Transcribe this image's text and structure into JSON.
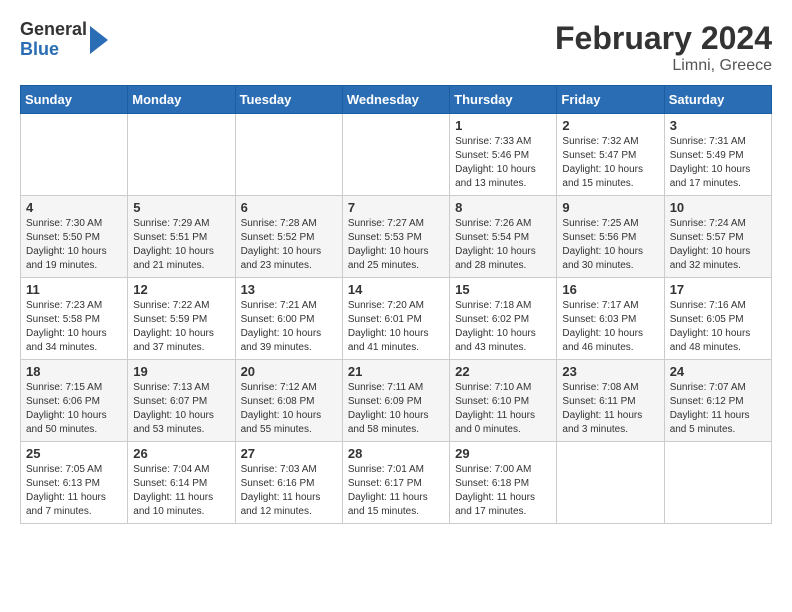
{
  "header": {
    "logo": {
      "general": "General",
      "blue": "Blue"
    },
    "title": "February 2024",
    "subtitle": "Limni, Greece"
  },
  "calendar": {
    "weekdays": [
      "Sunday",
      "Monday",
      "Tuesday",
      "Wednesday",
      "Thursday",
      "Friday",
      "Saturday"
    ],
    "weeks": [
      [
        {
          "day": "",
          "info": ""
        },
        {
          "day": "",
          "info": ""
        },
        {
          "day": "",
          "info": ""
        },
        {
          "day": "",
          "info": ""
        },
        {
          "day": "1",
          "info": "Sunrise: 7:33 AM\nSunset: 5:46 PM\nDaylight: 10 hours\nand 13 minutes."
        },
        {
          "day": "2",
          "info": "Sunrise: 7:32 AM\nSunset: 5:47 PM\nDaylight: 10 hours\nand 15 minutes."
        },
        {
          "day": "3",
          "info": "Sunrise: 7:31 AM\nSunset: 5:49 PM\nDaylight: 10 hours\nand 17 minutes."
        }
      ],
      [
        {
          "day": "4",
          "info": "Sunrise: 7:30 AM\nSunset: 5:50 PM\nDaylight: 10 hours\nand 19 minutes."
        },
        {
          "day": "5",
          "info": "Sunrise: 7:29 AM\nSunset: 5:51 PM\nDaylight: 10 hours\nand 21 minutes."
        },
        {
          "day": "6",
          "info": "Sunrise: 7:28 AM\nSunset: 5:52 PM\nDaylight: 10 hours\nand 23 minutes."
        },
        {
          "day": "7",
          "info": "Sunrise: 7:27 AM\nSunset: 5:53 PM\nDaylight: 10 hours\nand 25 minutes."
        },
        {
          "day": "8",
          "info": "Sunrise: 7:26 AM\nSunset: 5:54 PM\nDaylight: 10 hours\nand 28 minutes."
        },
        {
          "day": "9",
          "info": "Sunrise: 7:25 AM\nSunset: 5:56 PM\nDaylight: 10 hours\nand 30 minutes."
        },
        {
          "day": "10",
          "info": "Sunrise: 7:24 AM\nSunset: 5:57 PM\nDaylight: 10 hours\nand 32 minutes."
        }
      ],
      [
        {
          "day": "11",
          "info": "Sunrise: 7:23 AM\nSunset: 5:58 PM\nDaylight: 10 hours\nand 34 minutes."
        },
        {
          "day": "12",
          "info": "Sunrise: 7:22 AM\nSunset: 5:59 PM\nDaylight: 10 hours\nand 37 minutes."
        },
        {
          "day": "13",
          "info": "Sunrise: 7:21 AM\nSunset: 6:00 PM\nDaylight: 10 hours\nand 39 minutes."
        },
        {
          "day": "14",
          "info": "Sunrise: 7:20 AM\nSunset: 6:01 PM\nDaylight: 10 hours\nand 41 minutes."
        },
        {
          "day": "15",
          "info": "Sunrise: 7:18 AM\nSunset: 6:02 PM\nDaylight: 10 hours\nand 43 minutes."
        },
        {
          "day": "16",
          "info": "Sunrise: 7:17 AM\nSunset: 6:03 PM\nDaylight: 10 hours\nand 46 minutes."
        },
        {
          "day": "17",
          "info": "Sunrise: 7:16 AM\nSunset: 6:05 PM\nDaylight: 10 hours\nand 48 minutes."
        }
      ],
      [
        {
          "day": "18",
          "info": "Sunrise: 7:15 AM\nSunset: 6:06 PM\nDaylight: 10 hours\nand 50 minutes."
        },
        {
          "day": "19",
          "info": "Sunrise: 7:13 AM\nSunset: 6:07 PM\nDaylight: 10 hours\nand 53 minutes."
        },
        {
          "day": "20",
          "info": "Sunrise: 7:12 AM\nSunset: 6:08 PM\nDaylight: 10 hours\nand 55 minutes."
        },
        {
          "day": "21",
          "info": "Sunrise: 7:11 AM\nSunset: 6:09 PM\nDaylight: 10 hours\nand 58 minutes."
        },
        {
          "day": "22",
          "info": "Sunrise: 7:10 AM\nSunset: 6:10 PM\nDaylight: 11 hours\nand 0 minutes."
        },
        {
          "day": "23",
          "info": "Sunrise: 7:08 AM\nSunset: 6:11 PM\nDaylight: 11 hours\nand 3 minutes."
        },
        {
          "day": "24",
          "info": "Sunrise: 7:07 AM\nSunset: 6:12 PM\nDaylight: 11 hours\nand 5 minutes."
        }
      ],
      [
        {
          "day": "25",
          "info": "Sunrise: 7:05 AM\nSunset: 6:13 PM\nDaylight: 11 hours\nand 7 minutes."
        },
        {
          "day": "26",
          "info": "Sunrise: 7:04 AM\nSunset: 6:14 PM\nDaylight: 11 hours\nand 10 minutes."
        },
        {
          "day": "27",
          "info": "Sunrise: 7:03 AM\nSunset: 6:16 PM\nDaylight: 11 hours\nand 12 minutes."
        },
        {
          "day": "28",
          "info": "Sunrise: 7:01 AM\nSunset: 6:17 PM\nDaylight: 11 hours\nand 15 minutes."
        },
        {
          "day": "29",
          "info": "Sunrise: 7:00 AM\nSunset: 6:18 PM\nDaylight: 11 hours\nand 17 minutes."
        },
        {
          "day": "",
          "info": ""
        },
        {
          "day": "",
          "info": ""
        }
      ]
    ]
  }
}
